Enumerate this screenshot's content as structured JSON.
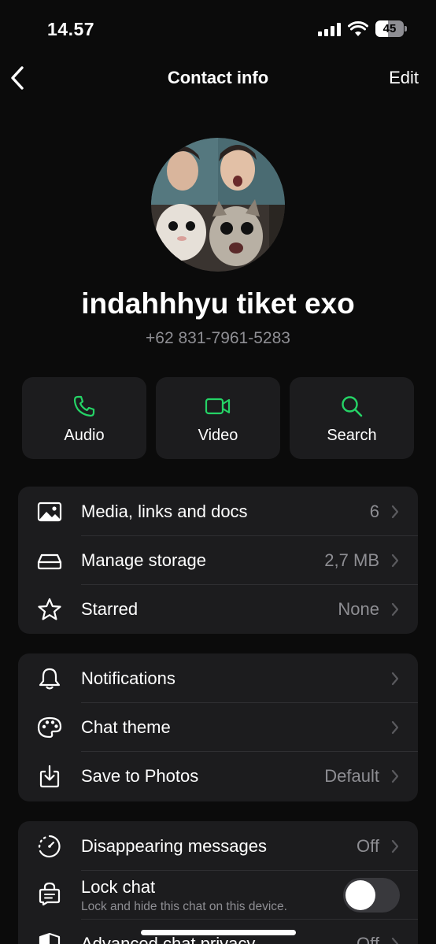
{
  "status_bar": {
    "time": "14.57",
    "battery_level": "45",
    "battery_fraction": 0.45
  },
  "nav": {
    "back_icon": "chevron-left-icon",
    "title": "Contact info",
    "edit_label": "Edit"
  },
  "contact": {
    "name": "indahhhyu tiket exo",
    "phone": "+62 831-7961-5283"
  },
  "actions": [
    {
      "label": "Audio",
      "icon": "phone-icon"
    },
    {
      "label": "Video",
      "icon": "video-camera-icon"
    },
    {
      "label": "Search",
      "icon": "search-icon"
    }
  ],
  "group1": [
    {
      "label": "Media, links and docs",
      "value": "6",
      "icon": "image-icon"
    },
    {
      "label": "Manage storage",
      "value": "2,7 MB",
      "icon": "storage-icon"
    },
    {
      "label": "Starred",
      "value": "None",
      "icon": "star-icon"
    }
  ],
  "group2": [
    {
      "label": "Notifications",
      "value": "",
      "icon": "bell-icon"
    },
    {
      "label": "Chat theme",
      "value": "",
      "icon": "palette-icon"
    },
    {
      "label": "Save to Photos",
      "value": "Default",
      "icon": "download-icon"
    }
  ],
  "group3": {
    "disappearing": {
      "label": "Disappearing messages",
      "value": "Off",
      "icon": "timer-icon"
    },
    "lock_chat": {
      "label": "Lock chat",
      "sublabel": "Lock and hide this chat on this device.",
      "enabled": false,
      "icon": "lock-chat-icon"
    },
    "advanced": {
      "label": "Advanced chat privacy",
      "value": "Off",
      "icon": "shield-icon"
    }
  },
  "colors": {
    "accent": "#25d366",
    "background": "#0b0b0b",
    "card": "#1c1c1e",
    "secondary_text": "#8e8e93"
  }
}
